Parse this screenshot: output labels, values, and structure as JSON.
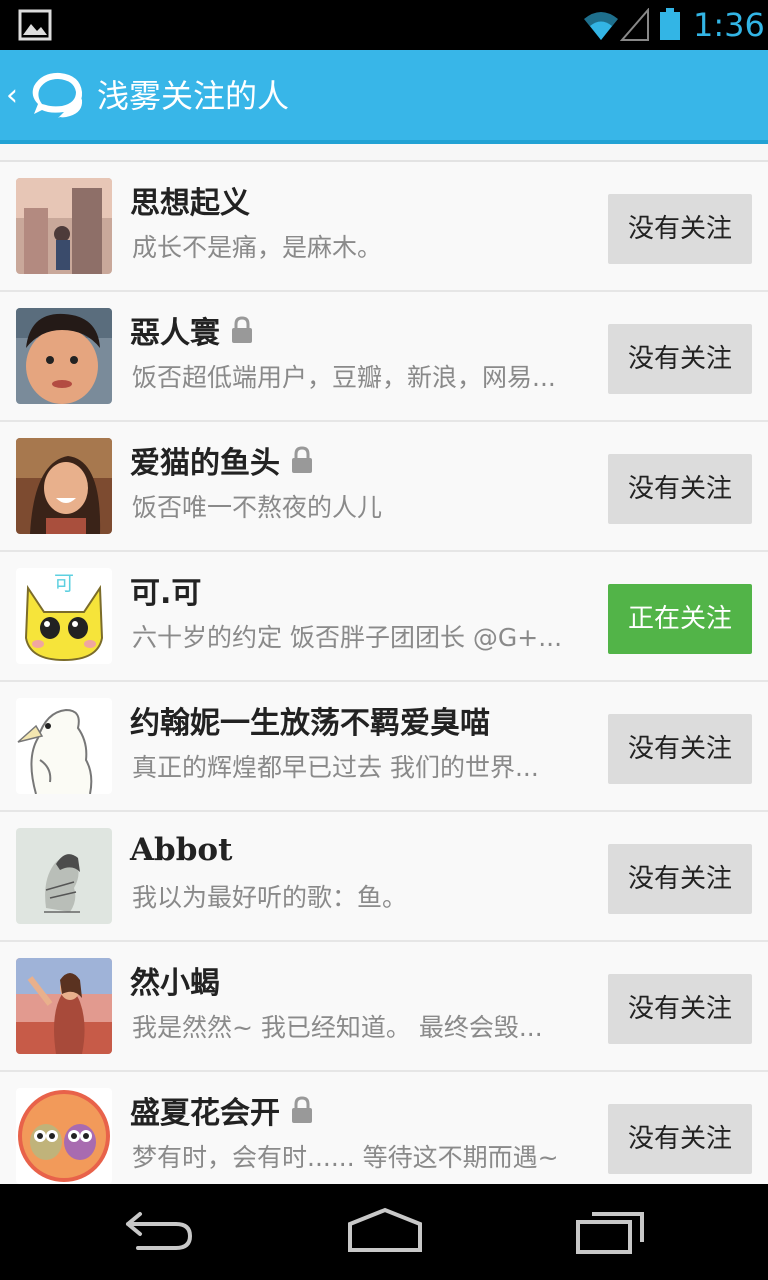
{
  "status_bar": {
    "time": "1:36",
    "icons": [
      "gallery-icon",
      "wifi-icon",
      "signal-icon",
      "battery-icon"
    ],
    "accent_color": "#33b5e5"
  },
  "action_bar": {
    "back_glyph": "‹",
    "title": "浅雾关注的人",
    "background_color": "#38b6e8"
  },
  "users": [
    {
      "name": "思想起义",
      "locked": false,
      "bio": "成长不是痛，是麻木。",
      "follow_label": "没有关注",
      "following": false
    },
    {
      "name": "惡人寰",
      "locked": true,
      "bio": "饭否超低端用户，豆瓣，新浪，网易...",
      "follow_label": "没有关注",
      "following": false
    },
    {
      "name": "爱猫的鱼头",
      "locked": true,
      "bio": "饭否唯一不熬夜的人儿",
      "follow_label": "没有关注",
      "following": false
    },
    {
      "name": "可.可",
      "locked": false,
      "bio": "六十岁的约定  饭否胖子团团长 @G+...",
      "follow_label": "正在关注",
      "following": true
    },
    {
      "name": "约翰妮一生放荡不羁爱臭喵",
      "locked": false,
      "bio": "真正的辉煌都早已过去 我们的世界...",
      "follow_label": "没有关注",
      "following": false
    },
    {
      "name": "Abbot",
      "locked": false,
      "bio": "我以为最好听的歌：鱼。",
      "follow_label": "没有关注",
      "following": false
    },
    {
      "name": "然小蝎",
      "locked": false,
      "bio": "我是然然~  我已经知道。 最终会毁...",
      "follow_label": "没有关注",
      "following": false
    },
    {
      "name": "盛夏花会开",
      "locked": true,
      "bio": "梦有时，会有时...... 等待这不期而遇~",
      "follow_label": "没有关注",
      "following": false
    }
  ],
  "avatar_text": {
    "keke": "可"
  },
  "colors": {
    "following_button": "#52b448",
    "not_following_button": "#dcdcdc"
  },
  "nav_bar": {
    "icons": [
      "back-icon",
      "home-icon",
      "recent-apps-icon"
    ]
  }
}
